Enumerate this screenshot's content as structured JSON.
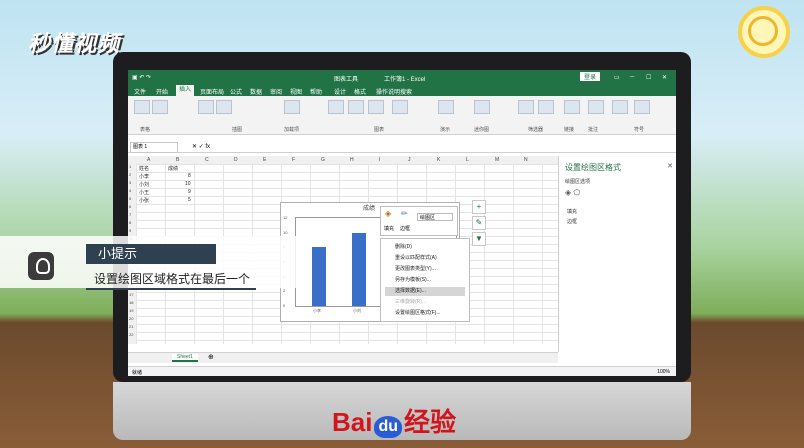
{
  "brand": {
    "logo_text": "秒懂视频"
  },
  "footer": {
    "baidu_prefix": "Bai",
    "baidu_du": "du",
    "baidu_suffix": "经验"
  },
  "excel": {
    "window_title": "工作簿1 - Excel",
    "chart_tools": "图表工具",
    "login": "登录",
    "menu": [
      "文件",
      "开始",
      "插入",
      "页面布局",
      "公式",
      "数据",
      "审阅",
      "视图",
      "帮助",
      "设计",
      "格式",
      "操作说明搜索"
    ],
    "active_menu": "插入",
    "ribbon_groups": [
      "表格",
      "插图",
      "加载项",
      "图表",
      "演示",
      "迷你图",
      "筛选器",
      "链接",
      "批注",
      "符号"
    ],
    "name_box": "图表 1",
    "columns": [
      "A",
      "B",
      "C",
      "D",
      "E",
      "F",
      "G",
      "H",
      "I",
      "J",
      "K",
      "L",
      "M",
      "N"
    ],
    "rows": [
      "1",
      "2",
      "3",
      "4",
      "5",
      "6",
      "7",
      "8",
      "9",
      "10",
      "11",
      "12",
      "13",
      "14",
      "15",
      "16",
      "17",
      "18",
      "19",
      "20",
      "21",
      "22"
    ],
    "table": {
      "header": [
        "姓名",
        "成绩"
      ],
      "rows": [
        [
          "小李",
          "8"
        ],
        [
          "小刘",
          "10"
        ],
        [
          "小王",
          "9"
        ],
        [
          "小张",
          "5"
        ]
      ]
    },
    "context_menu": {
      "fill_label": "填充",
      "outline_label": "边框",
      "dropdown": "绘图区",
      "items": [
        "删除(D)",
        "重设以匹配样式(A)",
        "更改图表类型(Y)...",
        "另存为模板(S)...",
        "选择数据(E)...",
        "三维旋转(R)...",
        "设置绘图区格式(F)..."
      ],
      "highlighted_index": 4
    },
    "side_pane": {
      "title": "设置绘图区格式",
      "subtitle": "绘图区选项",
      "items": [
        "填充",
        "边框"
      ]
    },
    "sheet_tab": "Sheet1",
    "status": "就绪",
    "zoom": "100%"
  },
  "tip": {
    "title": "小提示",
    "text": "设置绘图区域格式在最后一个"
  },
  "chart_data": {
    "type": "bar",
    "title": "成绩",
    "categories": [
      "小李",
      "小刘",
      "小王",
      "小张"
    ],
    "values": [
      8,
      10,
      9,
      5
    ],
    "ylim": [
      0,
      12
    ],
    "yticks": [
      "12",
      "10",
      "8",
      "6",
      "4",
      "2",
      "0"
    ],
    "visible_xlabels": [
      "小李",
      "小刘"
    ]
  }
}
